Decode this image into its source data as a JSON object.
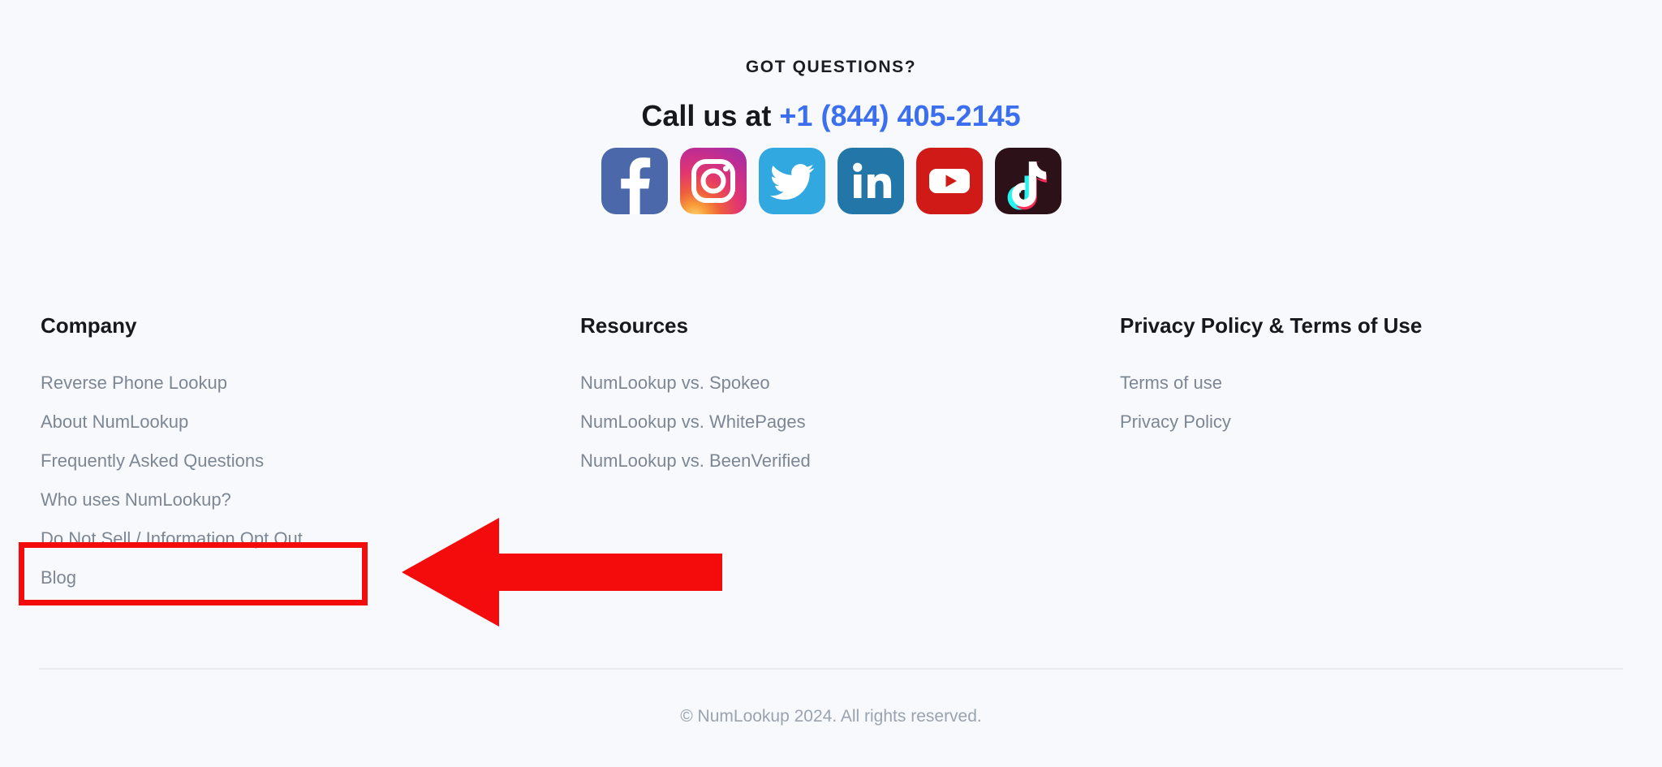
{
  "contact": {
    "heading": "GOT QUESTIONS?",
    "call_prefix": "Call us at ",
    "phone": "+1 (844) 405-2145",
    "phone_color": "#3b6ff0"
  },
  "social": {
    "items": [
      {
        "name": "facebook",
        "label": "Facebook",
        "color": "#4a68aa"
      },
      {
        "name": "instagram",
        "label": "Instagram",
        "color": "#e2366f"
      },
      {
        "name": "twitter",
        "label": "Twitter",
        "color": "#31a8e0"
      },
      {
        "name": "linkedin",
        "label": "LinkedIn",
        "color": "#2277a8"
      },
      {
        "name": "youtube",
        "label": "YouTube",
        "color": "#d01a17"
      },
      {
        "name": "tiktok",
        "label": "TikTok",
        "color": "#2d1119"
      }
    ]
  },
  "footer": {
    "columns": [
      {
        "heading": "Company",
        "links": [
          "Reverse Phone Lookup",
          "About NumLookup",
          "Frequently Asked Questions",
          "Who uses NumLookup?",
          "Do Not Sell / Information Opt Out",
          "Blog"
        ]
      },
      {
        "heading": "Resources",
        "links": [
          "NumLookup vs. Spokeo",
          "NumLookup vs. WhitePages",
          "NumLookup vs. BeenVerified"
        ]
      },
      {
        "heading": "Privacy Policy & Terms of Use",
        "links": [
          "Terms of use",
          "Privacy Policy"
        ]
      }
    ],
    "copyright": "© NumLookup 2024. All rights reserved."
  },
  "annotation": {
    "highlight_target": "Do Not Sell / Information Opt Out",
    "color": "#f40c0c",
    "arrow_direction": "left"
  },
  "theme": {
    "background": "#f7f9fc",
    "heading_color": "#16181d",
    "link_color": "#7d8794",
    "divider_color": "#e7ebf1",
    "copyright_color": "#9aa3b0"
  }
}
